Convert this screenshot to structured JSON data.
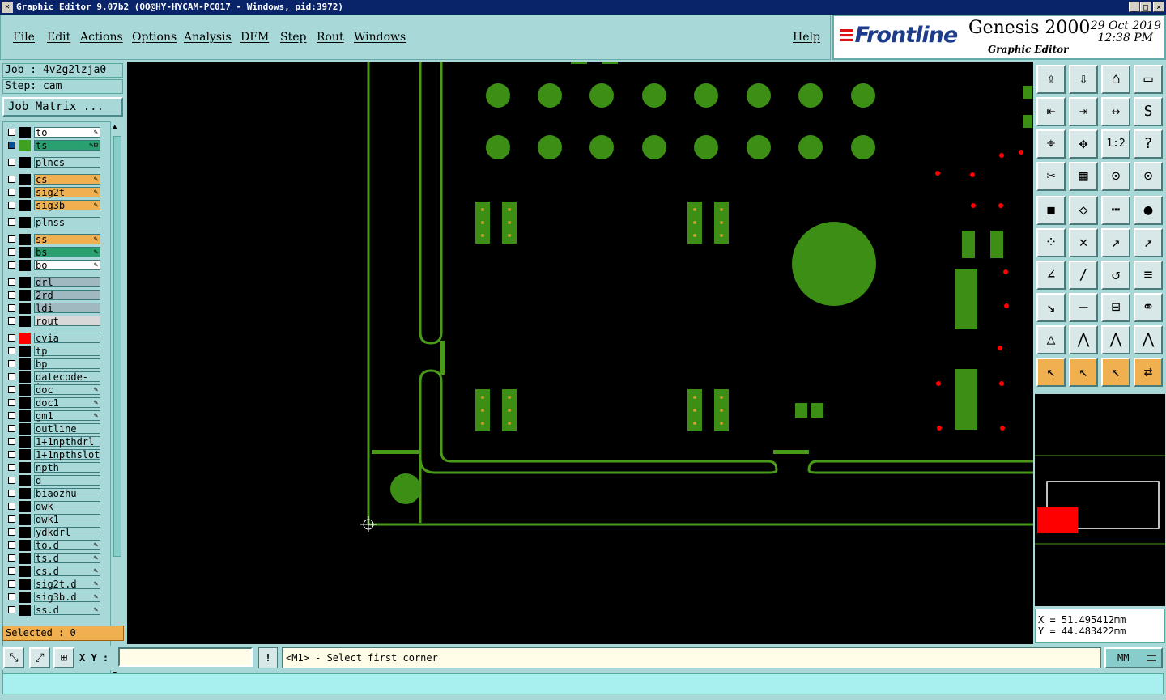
{
  "window": {
    "title": "Graphic Editor 9.07b2 (OO@HY-HYCAM-PC017 - Windows, pid:3972)",
    "controls": {
      "minimize": "_",
      "maximize": "□",
      "close": "×"
    }
  },
  "menu": [
    "File",
    "Edit",
    "Actions",
    "Options",
    "Analysis",
    "DFM",
    "Step",
    "Rout",
    "Windows"
  ],
  "help_label": "Help",
  "brand": {
    "logo": "Frontline",
    "product": "Genesis 2000",
    "subtitle": "Graphic Editor",
    "date": "29 Oct 2019",
    "time": "12:38 PM"
  },
  "job": {
    "label": "Job : 4v2g2lzja0",
    "step": "Step: cam",
    "matrix_button": "Job Matrix ..."
  },
  "layers": [
    {
      "name": "to",
      "color": "#ffffff",
      "marker": "#000000",
      "flag": "✎",
      "checked": false
    },
    {
      "name": "ts",
      "color": "#2aa070",
      "marker": "#40a020",
      "flag": "✎⊞",
      "checked": true
    },
    {
      "name": "plncs",
      "color": "#a8d8d8",
      "marker": "#000000",
      "flag": "",
      "checked": false
    },
    {
      "name": "cs",
      "color": "#f0b050",
      "marker": "#000000",
      "flag": "✎",
      "checked": false
    },
    {
      "name": "sig2t",
      "color": "#f0b050",
      "marker": "#000000",
      "flag": "✎",
      "checked": false
    },
    {
      "name": "sig3b",
      "color": "#f0b050",
      "marker": "#000000",
      "flag": "✎",
      "checked": false
    },
    {
      "name": "plnss",
      "color": "#a8d8d8",
      "marker": "#000000",
      "flag": "",
      "checked": false
    },
    {
      "name": "ss",
      "color": "#f0b050",
      "marker": "#000000",
      "flag": "✎",
      "checked": false
    },
    {
      "name": "bs",
      "color": "#2aa070",
      "marker": "#000000",
      "flag": "✎",
      "checked": false
    },
    {
      "name": "bo",
      "color": "#ffffff",
      "marker": "#000000",
      "flag": "✎",
      "checked": false
    },
    {
      "name": "drl",
      "color": "#a0b8c0",
      "marker": "#000000",
      "flag": "",
      "checked": false
    },
    {
      "name": "2rd",
      "color": "#a0b8c0",
      "marker": "#000000",
      "flag": "",
      "checked": false
    },
    {
      "name": "ldi",
      "color": "#a0b8c0",
      "marker": "#000000",
      "flag": "",
      "checked": false
    },
    {
      "name": "rout",
      "color": "#d8d8d8",
      "marker": "#000000",
      "flag": "",
      "checked": false
    },
    {
      "name": "cvia",
      "color": "#a8d8d8",
      "marker": "#ff0000",
      "flag": "",
      "checked": false
    },
    {
      "name": "tp",
      "color": "#a8d8d8",
      "marker": "#000000",
      "flag": "",
      "checked": false
    },
    {
      "name": "bp",
      "color": "#a8d8d8",
      "marker": "#000000",
      "flag": "",
      "checked": false
    },
    {
      "name": "datecode-to",
      "color": "#a8d8d8",
      "marker": "#000000",
      "flag": "",
      "checked": false
    },
    {
      "name": "doc",
      "color": "#a8d8d8",
      "marker": "#000000",
      "flag": "✎",
      "checked": false
    },
    {
      "name": "doc1",
      "color": "#a8d8d8",
      "marker": "#000000",
      "flag": "✎",
      "checked": false
    },
    {
      "name": "gm1",
      "color": "#a8d8d8",
      "marker": "#000000",
      "flag": "✎",
      "checked": false
    },
    {
      "name": "outline",
      "color": "#a8d8d8",
      "marker": "#000000",
      "flag": "",
      "checked": false
    },
    {
      "name": "1+1npthdrl",
      "color": "#a8d8d8",
      "marker": "#000000",
      "flag": "",
      "checked": false
    },
    {
      "name": "1+1npthslot",
      "color": "#a8d8d8",
      "marker": "#000000",
      "flag": "",
      "checked": false
    },
    {
      "name": "npth",
      "color": "#a8d8d8",
      "marker": "#000000",
      "flag": "",
      "checked": false
    },
    {
      "name": "d",
      "color": "#a8d8d8",
      "marker": "#000000",
      "flag": "",
      "checked": false
    },
    {
      "name": "biaozhu",
      "color": "#a8d8d8",
      "marker": "#000000",
      "flag": "",
      "checked": false
    },
    {
      "name": "dwk",
      "color": "#a8d8d8",
      "marker": "#000000",
      "flag": "",
      "checked": false
    },
    {
      "name": "dwk1",
      "color": "#a8d8d8",
      "marker": "#000000",
      "flag": "",
      "checked": false
    },
    {
      "name": "ydkdrl",
      "color": "#a8d8d8",
      "marker": "#000000",
      "flag": "",
      "checked": false
    },
    {
      "name": "to.d",
      "color": "#a8d8d8",
      "marker": "#000000",
      "flag": "✎",
      "checked": false
    },
    {
      "name": "ts.d",
      "color": "#a8d8d8",
      "marker": "#000000",
      "flag": "✎",
      "checked": false
    },
    {
      "name": "cs.d",
      "color": "#a8d8d8",
      "marker": "#000000",
      "flag": "✎",
      "checked": false
    },
    {
      "name": "sig2t.d",
      "color": "#a8d8d8",
      "marker": "#000000",
      "flag": "✎",
      "checked": false
    },
    {
      "name": "sig3b.d",
      "color": "#a8d8d8",
      "marker": "#000000",
      "flag": "✎",
      "checked": false
    },
    {
      "name": "ss.d",
      "color": "#a8d8d8",
      "marker": "#000000",
      "flag": "✎",
      "checked": false
    }
  ],
  "selected_label": "Selected : 0",
  "coords": {
    "x": "X = 51.495412mm",
    "y": "Y = 44.483422mm"
  },
  "command": {
    "xy_label": "X Y :",
    "xy_value": "",
    "exclaim": "!",
    "prompt": "<M1> - Select first corner",
    "units": "MM"
  },
  "toolbar_icons": [
    "open-icon",
    "save-icon",
    "home-icon",
    "window-icon",
    "prev-icon",
    "next-icon",
    "flip-icon",
    "snake-icon",
    "zoom-fit-icon",
    "center-icon",
    "ratio-icon",
    "help-icon",
    "measure-icon",
    "grid-icon",
    "snap-icon",
    "snap2-icon",
    "fill-icon",
    "outline-icon",
    "ruler-icon",
    "pad-icon",
    "connect-icon",
    "cross-icon",
    "line-pad-icon",
    "line-pad2-icon",
    "angle-icon",
    "diag-icon",
    "arc-icon",
    "split-icon",
    "move-pad-icon",
    "line-icon",
    "fit-icon",
    "shape-icon",
    "triangle-icon",
    "arch-icon",
    "arch2-icon",
    "arch3-icon",
    "pointer-icon",
    "pointer-box-icon",
    "pointer-select-icon",
    "route-icon"
  ],
  "toolbar_labels": {
    "ratio": "1:2",
    "help": "?"
  },
  "colors": {
    "board": "#4a9a1a",
    "pad": "#3c8f14",
    "via": "#ff0000",
    "accent": "#f0b050"
  }
}
